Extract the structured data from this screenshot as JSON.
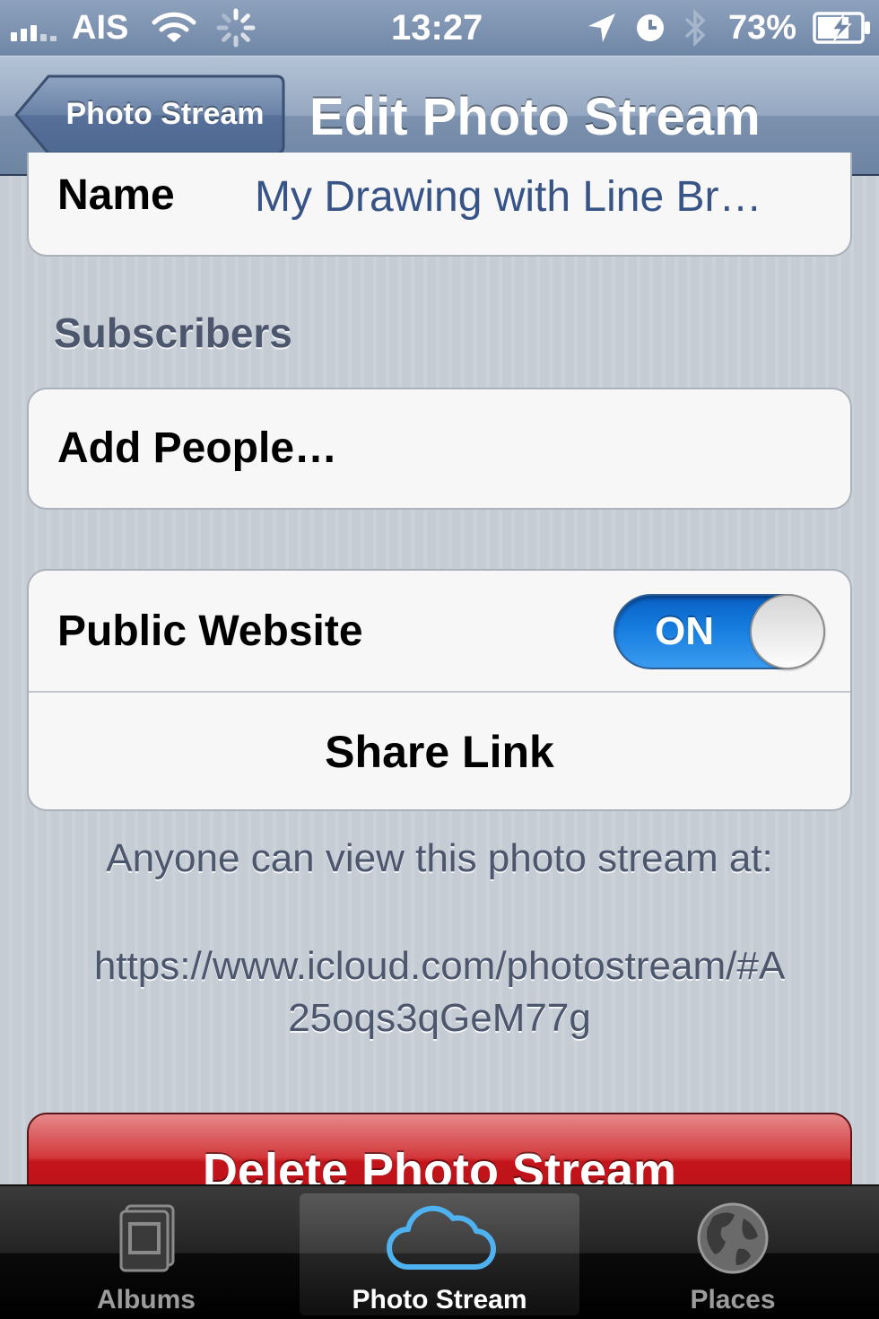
{
  "status_bar": {
    "carrier": "AIS",
    "time": "13:27",
    "battery_percent": "73%",
    "icons": [
      "signal-icon",
      "wifi-icon",
      "activity-spinner-icon",
      "location-icon",
      "alarm-icon",
      "bluetooth-icon",
      "battery-charging-icon"
    ]
  },
  "nav_bar": {
    "back_label": "Photo Stream",
    "title": "Edit Photo Stream"
  },
  "form": {
    "name_label": "Name",
    "name_value": "My Drawing with Line Br…",
    "subscribers_header": "Subscribers",
    "add_people_label": "Add People…",
    "public_website_label": "Public Website",
    "public_website_toggle": "ON",
    "public_website_on": true,
    "share_link_label": "Share Link",
    "footer_line": "Anyone can view this photo stream at:",
    "url_line1": "https://www.icloud.com/photostream/#A",
    "url_line2": "25oqs3qGeM77g",
    "delete_label": "Delete Photo Stream"
  },
  "tab_bar": {
    "tabs": [
      {
        "label": "Albums",
        "icon": "albums-icon",
        "active": false
      },
      {
        "label": "Photo Stream",
        "icon": "cloud-icon",
        "active": true
      },
      {
        "label": "Places",
        "icon": "globe-icon",
        "active": false
      }
    ]
  },
  "colors": {
    "nav_bar": "#7b91ae",
    "value_text": "#385487",
    "toggle_on": "#167ddf",
    "delete_button": "#c3141a",
    "tab_bar": "#000000"
  }
}
